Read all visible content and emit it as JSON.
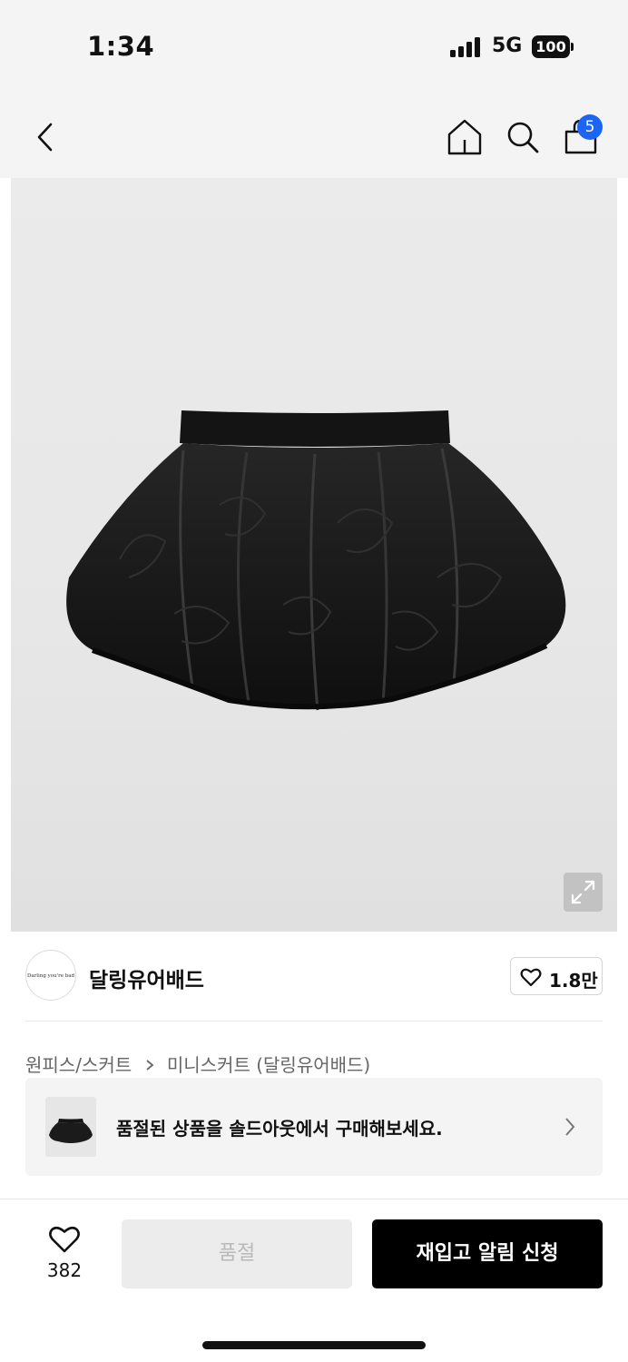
{
  "status_bar": {
    "time": "1:34",
    "network": "5G",
    "battery": "100",
    "signal_bars": 4
  },
  "header": {
    "icons": [
      "back-icon",
      "home-icon",
      "search-icon",
      "cart-icon"
    ],
    "cart_badge": "5",
    "badge_color": "#1c64f2"
  },
  "product_image": {
    "subject": "black-bubble-skirt",
    "expand_icon": "expand-icon"
  },
  "shop": {
    "logo_text": "Darling you're bad",
    "name": "달링유어배드",
    "like_count": "1.8만"
  },
  "breadcrumb": {
    "items": [
      "원피스/스커트",
      "미니스커트 (달링유어배드)"
    ]
  },
  "soldout_banner": {
    "text": "품절된 상품을 솔드아웃에서 구매해보세요."
  },
  "bottom_bar": {
    "wish_count": "382",
    "soldout_label": "품절",
    "restock_label": "재입고 알림 신청"
  }
}
